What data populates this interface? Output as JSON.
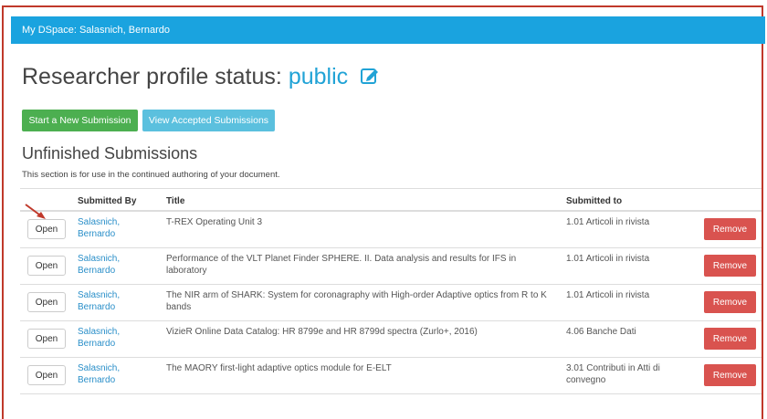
{
  "header": {
    "title": "My DSpace: Salasnich, Bernardo"
  },
  "profile": {
    "label": "Researcher profile status:",
    "status": "public"
  },
  "actions": {
    "new_submission": "Start a New Submission",
    "view_accepted": "View Accepted Submissions"
  },
  "section": {
    "title": "Unfinished Submissions",
    "description": "This section is for use in the continued authoring of your document."
  },
  "table": {
    "headers": {
      "submitted_by": "Submitted By",
      "title": "Title",
      "submitted_to": "Submitted to"
    },
    "rows": [
      {
        "open": "Open",
        "submitter": "Salasnich, Bernardo",
        "title": "T-REX Operating Unit 3",
        "submitted_to": "1.01 Articoli in rivista",
        "remove": "Remove"
      },
      {
        "open": "Open",
        "submitter": "Salasnich, Bernardo",
        "title": "Performance of the VLT Planet Finder SPHERE. II. Data analysis and results for IFS in laboratory",
        "submitted_to": "1.01 Articoli in rivista",
        "remove": "Remove"
      },
      {
        "open": "Open",
        "submitter": "Salasnich, Bernardo",
        "title": "The NIR arm of SHARK: System for coronagraphy with High-order Adaptive optics from R to K bands",
        "submitted_to": "1.01 Articoli in rivista",
        "remove": "Remove"
      },
      {
        "open": "Open",
        "submitter": "Salasnich, Bernardo",
        "title": "VizieR Online Data Catalog: HR 8799e and HR 8799d spectra (Zurlo+, 2016)",
        "submitted_to": "4.06 Banche Dati",
        "remove": "Remove"
      },
      {
        "open": "Open",
        "submitter": "Salasnich, Bernardo",
        "title": "The MAORY first-light adaptive optics module for E-ELT",
        "submitted_to": "3.01 Contributi in Atti di convegno",
        "remove": "Remove"
      }
    ]
  },
  "colors": {
    "topbar": "#1aa3df",
    "green": "#4caf50",
    "blue": "#5bc0de",
    "red": "#d9534f",
    "link": "#2a8fc9",
    "annotation": "#c0392b"
  },
  "icons": {
    "edit": "edit-icon",
    "arrow": "annotation-arrow-icon"
  }
}
